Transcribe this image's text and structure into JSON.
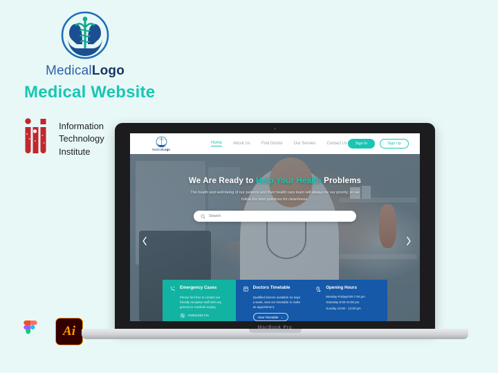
{
  "branding": {
    "logo": {
      "icon_name": "caduceus-hands-logo",
      "text_light": "Medical",
      "text_bold": "Logo"
    },
    "page_title": "Medical Website",
    "institute": {
      "icon_name": "iti-logo",
      "line1": "Information",
      "line2": "Technology",
      "line3": "Institute"
    },
    "tools": [
      {
        "name": "figma-icon",
        "label": "Figma"
      },
      {
        "name": "illustrator-icon",
        "label": "Ai"
      }
    ]
  },
  "device": {
    "model_label": "MacBook Pro"
  },
  "site": {
    "nav": {
      "logo_text_light": "Medical",
      "logo_text_bold": "Logo",
      "links": [
        {
          "label": "Home",
          "active": true
        },
        {
          "label": "About Us",
          "active": false
        },
        {
          "label": "Find Doctor",
          "active": false
        },
        {
          "label": "Our Servies",
          "active": false
        },
        {
          "label": "Contact Us",
          "active": false
        }
      ],
      "sign_in": "Sign In",
      "sign_up": "Sign Up"
    },
    "hero": {
      "title_part1": "We Are Ready to ",
      "title_highlight": "Help Your Health",
      "title_part2": " Problems",
      "subtitle": "The health and well-being of our patients and their health care team will always be our priority, so we follow the best practices for cleanliness.",
      "search_placeholder": "Search",
      "search_value": "",
      "prev_arrow": "‹",
      "next_arrow": "›"
    },
    "cards": {
      "emergency": {
        "icon_name": "emergency-call-icon",
        "title": "Emergency Cases",
        "body": "Please feel free to contact our friendly reception staff with any general or medical enquiry.",
        "phone": "01061261741"
      },
      "timetable": {
        "icon_name": "calendar-icon",
        "title": "Doctors Timetable",
        "body": "Qualified doctors available six days a week, view our timetable to make an appointment.",
        "button": "View Timetable",
        "button_arrow": "→"
      },
      "hours": {
        "icon_name": "clock-hours-icon",
        "title": "Opening Hours",
        "rows": [
          "Monday-Friday8:00-7:00 pm",
          "Saturday 9:00-10:00 pm",
          "Sunday 10:00 - 12:00 pm"
        ]
      }
    }
  },
  "colors": {
    "background": "#e8f8f7",
    "teal": "#18c6b4",
    "card_teal": "#12b3a2",
    "card_blue": "#1559a8",
    "logo_blue": "#1b3f7a",
    "iti_red": "#c1272d"
  }
}
